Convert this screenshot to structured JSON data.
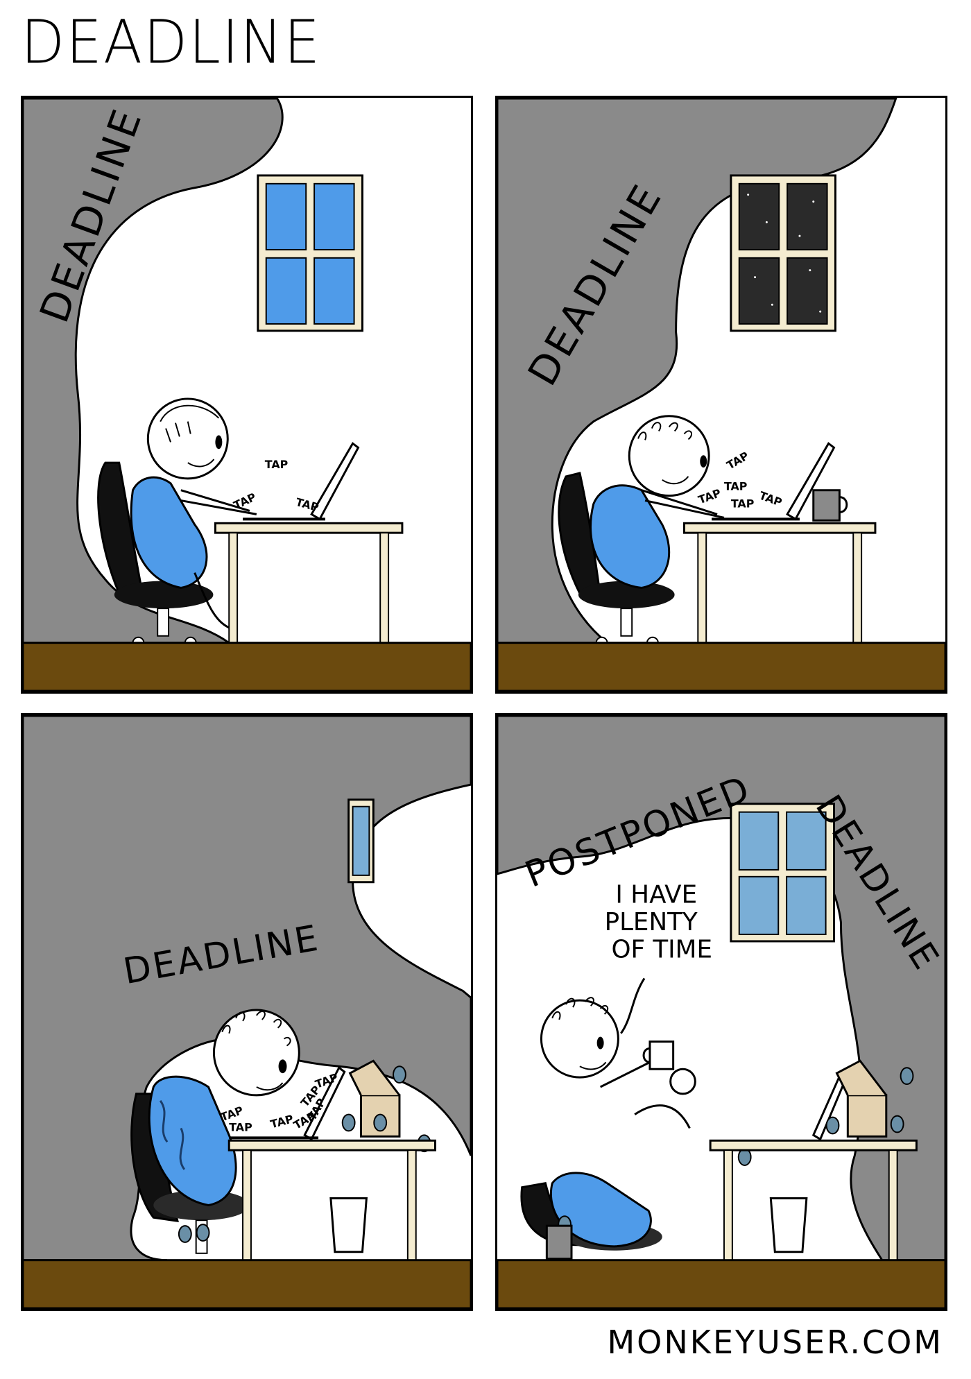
{
  "title": "DEADLINE",
  "credit": "MONKEYUSER.COM",
  "colors": {
    "cloud": "#8a8a8a",
    "floor": "#6b4a0e",
    "shirt": "#4f9be9",
    "window_day": "#4f9be9",
    "window_night": "#2a2a2a",
    "window_dusk": "#7aaed6",
    "frame": "#f4ecd0"
  },
  "panels": [
    {
      "label": "DEADLINE",
      "taps": [
        "TAP",
        "TAP",
        "TAP"
      ]
    },
    {
      "label": "DEADLINE",
      "taps": [
        "TAP",
        "TAP",
        "TAP",
        "TAP",
        "TAP"
      ]
    },
    {
      "label": "DEADLINE",
      "taps": [
        "TAP",
        "TAP",
        "TAP",
        "TAP",
        "TAP",
        "TAP",
        "TAP"
      ]
    },
    {
      "label_left": "POSTPONED",
      "label_right": "DEADLINE",
      "speech": [
        "I HAVE",
        "PLENTY",
        "OF TIME"
      ]
    }
  ]
}
